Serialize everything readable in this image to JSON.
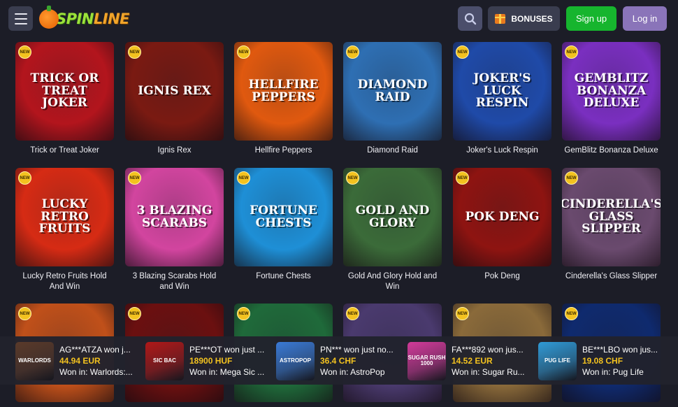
{
  "header": {
    "logo_spin": "SPIN",
    "logo_line": "LINE",
    "bonuses_label": "BONUSES",
    "signup_label": "Sign up",
    "login_label": "Log in"
  },
  "badge_text": "NEW",
  "games": [
    {
      "title": "Trick or Treat Joker",
      "art": "Trick or Treat Joker",
      "color": "#b3151d"
    },
    {
      "title": "Ignis Rex",
      "art": "Ignis Rex",
      "color": "#7a1a12"
    },
    {
      "title": "Hellfire Peppers",
      "art": "Hellfire Peppers",
      "color": "#e0590f"
    },
    {
      "title": "Diamond Raid",
      "art": "Diamond Raid",
      "color": "#2e6fb3"
    },
    {
      "title": "Joker's Luck Respin",
      "art": "Joker's Luck Respin",
      "color": "#1f4aa8"
    },
    {
      "title": "GemBlitz Bonanza Deluxe",
      "art": "GemBlitz Bonanza Deluxe",
      "color": "#7a2fc0"
    },
    {
      "title": "Lucky Retro Fruits Hold And Win",
      "art": "Lucky Retro Fruits",
      "color": "#d62b14"
    },
    {
      "title": "3 Blazing Scarabs Hold and Win",
      "art": "3 Blazing Scarabs",
      "color": "#d2459f"
    },
    {
      "title": "Fortune Chests",
      "art": "Fortune Chests",
      "color": "#1e8fd6"
    },
    {
      "title": "Gold And Glory Hold and Win",
      "art": "Gold and Glory",
      "color": "#3b6b39"
    },
    {
      "title": "Pok Deng",
      "art": "Pok Deng",
      "color": "#8e1411"
    },
    {
      "title": "Cinderella's Glass Slipper",
      "art": "Cinderella's Glass Slipper",
      "color": "#6a4a6e"
    },
    {
      "title": "",
      "art": "",
      "color": "#c0501a"
    },
    {
      "title": "",
      "art": "",
      "color": "#6b1010"
    },
    {
      "title": "",
      "art": "",
      "color": "#1f6a3a"
    },
    {
      "title": "",
      "art": "",
      "color": "#4a3a6e"
    },
    {
      "title": "",
      "art": "",
      "color": "#8a6a3a"
    },
    {
      "title": "",
      "art": "",
      "color": "#0f2a6e"
    }
  ],
  "recent_wins": [
    {
      "user": "AG***ATZA won j...",
      "amount": "44.94 EUR",
      "game": "Won in: Warlords:...",
      "thumb": "WARLORDS",
      "color": "#5a3a2a"
    },
    {
      "user": "PE***OT won just ...",
      "amount": "18900 HUF",
      "game": "Won in: Mega Sic ...",
      "thumb": "SIC BAC",
      "color": "#b01818"
    },
    {
      "user": "PN*** won just no...",
      "amount": "36.4 CHF",
      "game": "Won in: AstroPop",
      "thumb": "ASTROPOP",
      "color": "#3a7ad6"
    },
    {
      "user": "FA***892 won jus...",
      "amount": "14.52 EUR",
      "game": "Won in: Sugar Ru...",
      "thumb": "SUGAR RUSH 1000",
      "color": "#d23a9a"
    },
    {
      "user": "BE***LBO won jus...",
      "amount": "19.08 CHF",
      "game": "Won in: Pug Life",
      "thumb": "PUG LIFE",
      "color": "#2f9ad6"
    }
  ]
}
